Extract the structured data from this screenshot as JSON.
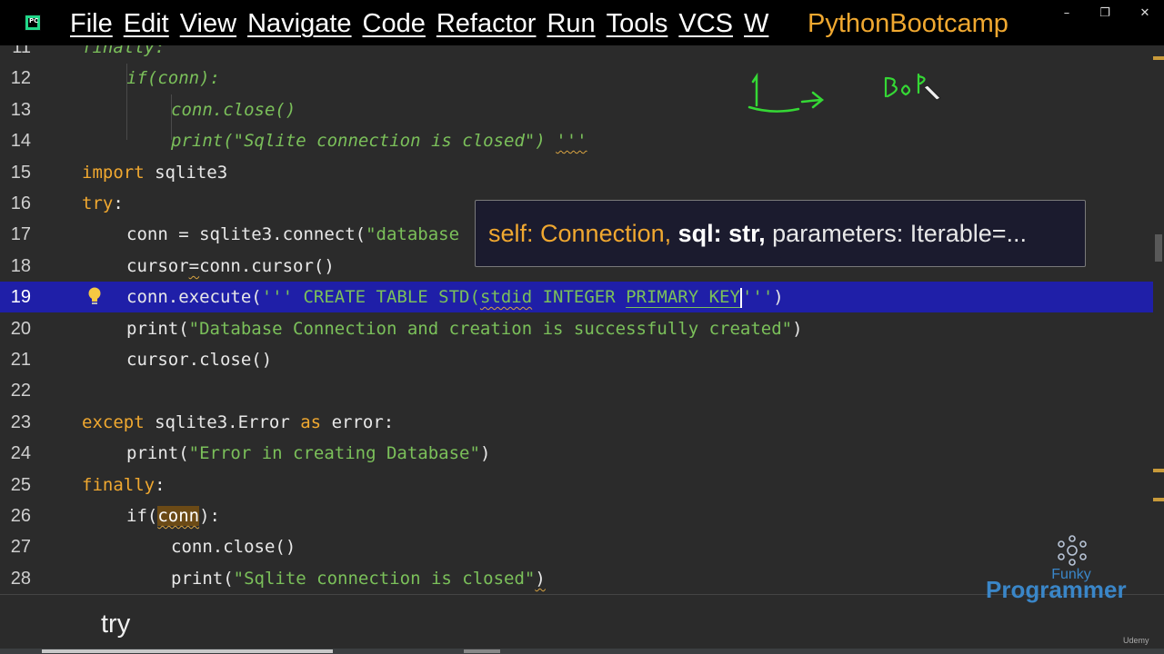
{
  "titlebar": {
    "menu": [
      "File",
      "Edit",
      "View",
      "Navigate",
      "Code",
      "Refactor",
      "Run",
      "Tools",
      "VCS",
      "W"
    ],
    "project": "PythonBootcamp",
    "app_icon_label": "PC"
  },
  "editor": {
    "current_line": 19,
    "lines": [
      {
        "num": "11",
        "parts": [
          {
            "t": "finally:",
            "c": "cmt-kw"
          }
        ],
        "indent": 90
      },
      {
        "num": "12",
        "parts": [
          {
            "t": "if(conn):",
            "c": "cmt"
          }
        ],
        "indent": 139
      },
      {
        "num": "13",
        "parts": [
          {
            "t": "conn.close()",
            "c": "cmt"
          }
        ],
        "indent": 188
      },
      {
        "num": "14",
        "parts": [
          {
            "t": "print(\"Sqlite connection is closed\") ",
            "c": "cmt"
          },
          {
            "t": "'''",
            "c": "cmt squiggle"
          }
        ],
        "indent": 188
      },
      {
        "num": "15",
        "parts": [
          {
            "t": "import",
            "c": "kw"
          },
          {
            "t": " sqlite3",
            "c": ""
          }
        ],
        "indent": 90
      },
      {
        "num": "16",
        "parts": [
          {
            "t": "try",
            "c": "kw"
          },
          {
            "t": ":",
            "c": ""
          }
        ],
        "indent": 90
      },
      {
        "num": "17",
        "parts": [
          {
            "t": "conn = sqlite3.connect(",
            "c": ""
          },
          {
            "t": "\"database",
            "c": "str"
          }
        ],
        "indent": 139
      },
      {
        "num": "18",
        "parts": [
          {
            "t": "cursor",
            "c": ""
          },
          {
            "t": "=",
            "c": "squiggle"
          },
          {
            "t": "conn.cursor()",
            "c": ""
          }
        ],
        "indent": 139
      },
      {
        "num": "19",
        "parts": [
          {
            "t": "conn.execute(",
            "c": ""
          },
          {
            "t": "''' CREATE TABLE STD(",
            "c": "sql"
          },
          {
            "t": "stdid",
            "c": "sql squiggle"
          },
          {
            "t": " INTEGER ",
            "c": "sql"
          },
          {
            "t": "PRIMARY KEY",
            "c": "sql ul-green"
          },
          {
            "t": "CARET",
            "c": "caret"
          },
          {
            "t": "'''",
            "c": "sql"
          },
          {
            "t": ")",
            "c": ""
          }
        ],
        "indent": 139
      },
      {
        "num": "20",
        "parts": [
          {
            "t": "print(",
            "c": ""
          },
          {
            "t": "\"Database Connection and creation is successfully created\"",
            "c": "str"
          },
          {
            "t": ")",
            "c": ""
          }
        ],
        "indent": 139
      },
      {
        "num": "21",
        "parts": [
          {
            "t": "cursor.close()",
            "c": ""
          }
        ],
        "indent": 139
      },
      {
        "num": "22",
        "parts": [],
        "indent": 139
      },
      {
        "num": "23",
        "parts": [
          {
            "t": "except",
            "c": "kw"
          },
          {
            "t": " sqlite3.Error ",
            "c": ""
          },
          {
            "t": "as",
            "c": "kw"
          },
          {
            "t": " error:",
            "c": ""
          }
        ],
        "indent": 90
      },
      {
        "num": "24",
        "parts": [
          {
            "t": "print(",
            "c": ""
          },
          {
            "t": "\"Error in creating Database\"",
            "c": "str"
          },
          {
            "t": ")",
            "c": ""
          }
        ],
        "indent": 139
      },
      {
        "num": "25",
        "parts": [
          {
            "t": "finally",
            "c": "kw"
          },
          {
            "t": ":",
            "c": ""
          }
        ],
        "indent": 90
      },
      {
        "num": "26",
        "parts": [
          {
            "t": "if(",
            "c": ""
          },
          {
            "t": "conn",
            "c": "hl-var squiggle"
          },
          {
            "t": "):",
            "c": ""
          }
        ],
        "indent": 139
      },
      {
        "num": "27",
        "parts": [
          {
            "t": "conn.close()",
            "c": ""
          }
        ],
        "indent": 188
      },
      {
        "num": "28",
        "parts": [
          {
            "t": "print(",
            "c": ""
          },
          {
            "t": "\"Sqlite connection is closed\"",
            "c": "str"
          },
          {
            "t": ")",
            "c": "squiggle"
          }
        ],
        "indent": 188
      }
    ]
  },
  "param_hint": {
    "before": "self: Connection, ",
    "current": "sql: str,",
    "after": " parameters: Iterable=..."
  },
  "breadcrumb": "try",
  "logo": {
    "tag": "Funky",
    "name": "Programmer",
    "platform": "Udemy"
  },
  "colors": {
    "keyword": "#f0a830",
    "string": "#7bc05a",
    "current_line": "#1f1fa8",
    "background": "#2b2b2b",
    "logo": "#3a86c8"
  }
}
